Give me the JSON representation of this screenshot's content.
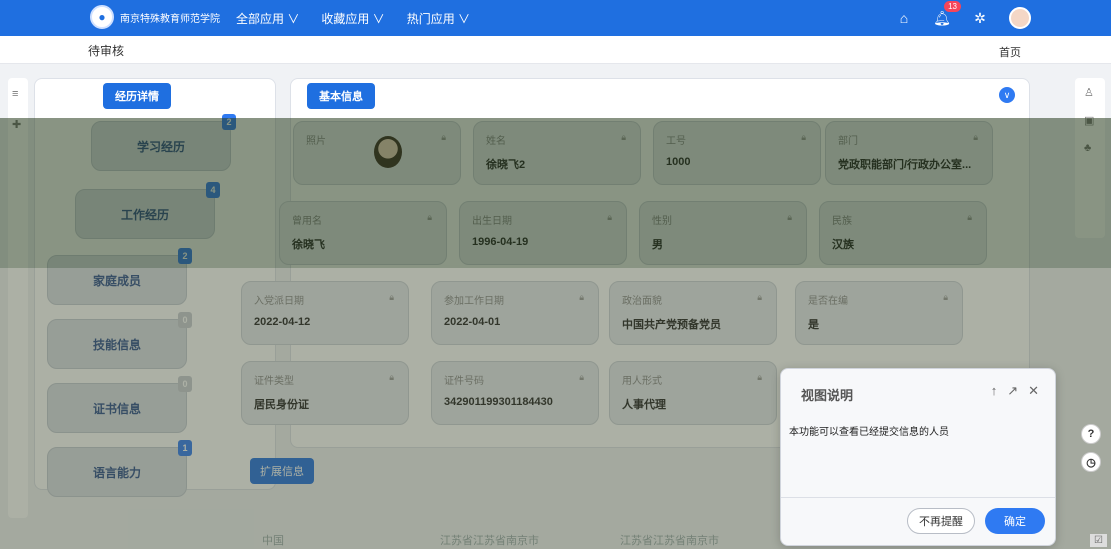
{
  "header": {
    "org_name": "南京特殊教育师范学院",
    "nav": [
      "全部应用 ∨",
      "收藏应用 ∨",
      "热门应用 ∨"
    ],
    "notify_count": "13"
  },
  "subbar": {
    "crumb": "待审核",
    "home": "首页"
  },
  "left_panel": {
    "chip": "经历详情",
    "items": [
      {
        "label": "学习经历",
        "count": "2"
      },
      {
        "label": "工作经历",
        "count": "4"
      },
      {
        "label": "家庭成员",
        "count": "2"
      },
      {
        "label": "技能信息",
        "count": "0"
      },
      {
        "label": "证书信息",
        "count": "0"
      },
      {
        "label": "语言能力",
        "count": "1"
      }
    ]
  },
  "main_panel": {
    "chip": "基本信息",
    "fields": [
      {
        "label": "照片",
        "value": ""
      },
      {
        "label": "姓名",
        "value": "徐晓飞2"
      },
      {
        "label": "工号",
        "value": "1000"
      },
      {
        "label": "部门",
        "value": "党政职能部门/行政办公室..."
      },
      {
        "label": "曾用名",
        "value": "徐晓飞"
      },
      {
        "label": "出生日期",
        "value": "1996-04-19"
      },
      {
        "label": "性别",
        "value": "男"
      },
      {
        "label": "民族",
        "value": "汉族"
      },
      {
        "label": "入党派日期",
        "value": "2022-04-12"
      },
      {
        "label": "参加工作日期",
        "value": "2022-04-01"
      },
      {
        "label": "政治面貌",
        "value": "中国共产党预备党员"
      },
      {
        "label": "是否在编",
        "value": "是"
      },
      {
        "label": "证件类型",
        "value": "居民身份证"
      },
      {
        "label": "证件号码",
        "value": "342901199301184430"
      },
      {
        "label": "用人形式",
        "value": "人事代理"
      }
    ],
    "ext_chip": "扩展信息",
    "ext_hints": [
      "中国",
      "江苏省江苏省南京市",
      "江苏省江苏省南京市"
    ]
  },
  "dialog": {
    "title": "视图说明",
    "body": "本功能可以查看已经提交信息的人员",
    "dismiss": "不再提醒",
    "confirm": "确定"
  }
}
